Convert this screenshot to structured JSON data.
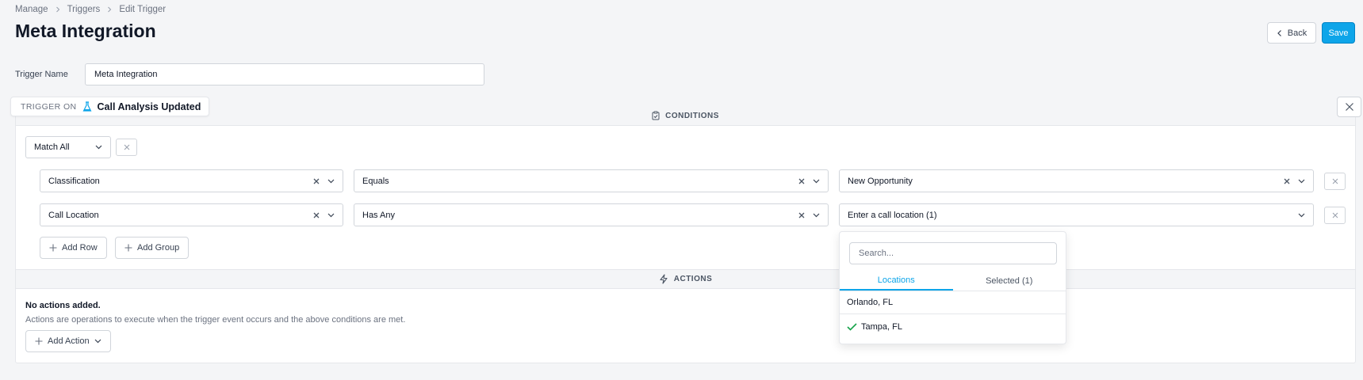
{
  "breadcrumb": {
    "items": [
      "Manage",
      "Triggers",
      "Edit Trigger"
    ]
  },
  "page": {
    "title": "Meta Integration"
  },
  "header_buttons": {
    "back": "Back",
    "save": "Save"
  },
  "trigger_name": {
    "label": "Trigger Name",
    "value": "Meta Integration"
  },
  "trigger_on": {
    "label": "TRIGGER ON",
    "value": "Call Analysis Updated"
  },
  "conditions": {
    "header": "CONDITIONS",
    "match": "Match All",
    "rows": [
      {
        "field": "Classification",
        "operator": "Equals",
        "value": "New Opportunity"
      },
      {
        "field": "Call Location",
        "operator": "Has Any",
        "value": "Enter a call location (1)"
      }
    ],
    "add_row": "Add Row",
    "add_group": "Add Group"
  },
  "dropdown": {
    "search_placeholder": "Search...",
    "tabs": [
      "Locations",
      "Selected (1)"
    ],
    "items": [
      {
        "label": "Orlando, FL",
        "selected": false
      },
      {
        "label": "Tampa, FL",
        "selected": true
      }
    ]
  },
  "actions": {
    "header": "ACTIONS",
    "empty_title": "No actions added.",
    "empty_desc": "Actions are operations to execute when the trigger event occurs and the above conditions are met.",
    "add_action": "Add Action"
  },
  "colors": {
    "accent": "#0ea5e9",
    "check": "#16a34a"
  }
}
